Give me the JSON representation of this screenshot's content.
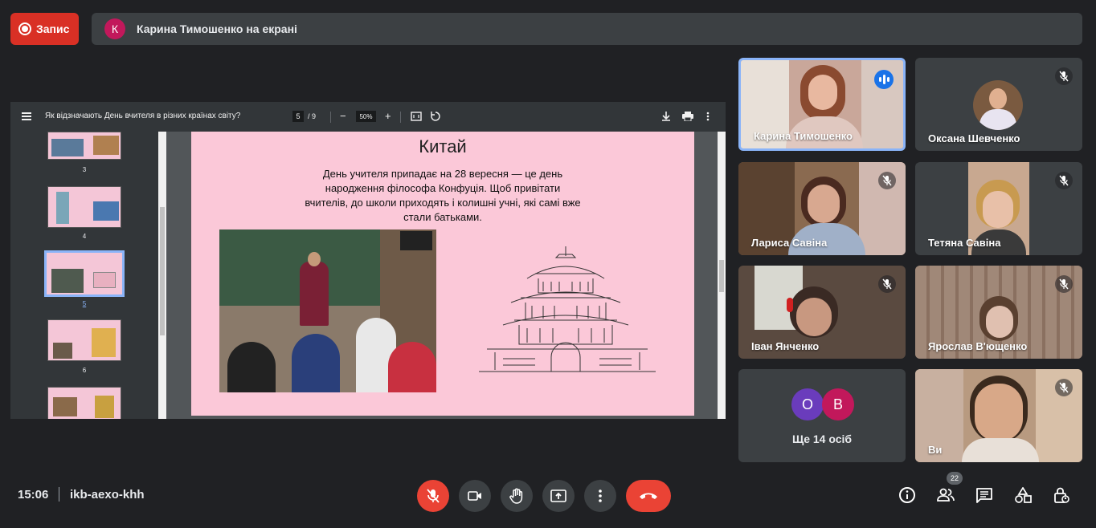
{
  "top": {
    "record_label": "Запис",
    "presenter_initial": "К",
    "presenter_text": "Карина Тимошенко на екрані"
  },
  "pdf": {
    "title": "Як відзначають День вчителя в різних країнах світу?",
    "current_page": "5",
    "page_total": "/ 9",
    "zoom": "50%",
    "zoom_out": "−",
    "zoom_in": "+",
    "thumb_labels": [
      "3",
      "4",
      "5",
      "6"
    ]
  },
  "slide": {
    "title": "Китай",
    "text": "День учителя припадає на 28 вересня — це день народження філософа Конфуція. Щоб привітати вчителів, до школи приходять і колишні учні, які самі вже стали батьками."
  },
  "participants": [
    {
      "name": "Карина Тимошенко",
      "state": "speaking"
    },
    {
      "name": "Оксана Шевченко",
      "state": "muted"
    },
    {
      "name": "Лариса Савіна",
      "state": "muted"
    },
    {
      "name": "Тетяна Савіна",
      "state": "muted"
    },
    {
      "name": "Іван Янченко",
      "state": "muted"
    },
    {
      "name": "Ярослав В'ющенко",
      "state": "muted"
    },
    {
      "name": "Ви",
      "state": "muted"
    }
  ],
  "more": {
    "initial_1": "О",
    "initial_2": "В",
    "text": "Ще 14 осіб"
  },
  "bottom": {
    "time": "15:06",
    "meeting_code": "ikb-aexo-khh",
    "people_count": "22"
  },
  "colors": {
    "background": "#202124",
    "record_red": "#d93025",
    "speaking_blue": "#1a73e8",
    "end_call_red": "#ea4335",
    "slide_pink": "#fbc8d8",
    "avatar_o": "#6a3cbc",
    "avatar_b": "#c2185b"
  }
}
